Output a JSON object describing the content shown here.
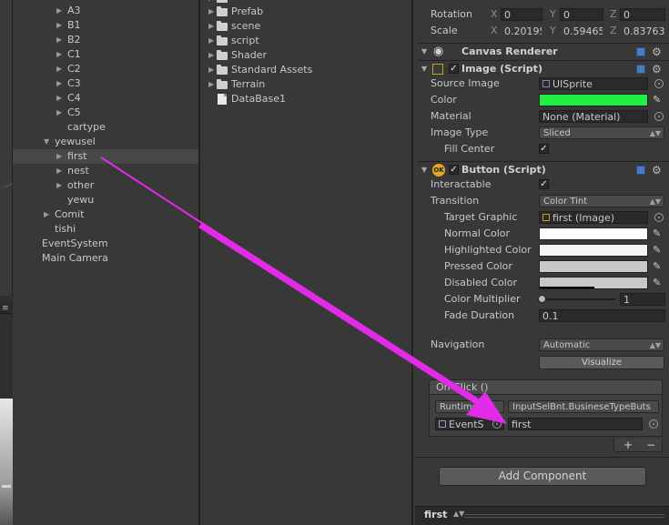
{
  "hierarchy": {
    "items": [
      {
        "label": "A3",
        "indent": 3,
        "expand": "collapsed"
      },
      {
        "label": "B1",
        "indent": 3,
        "expand": "collapsed"
      },
      {
        "label": "B2",
        "indent": 3,
        "expand": "collapsed"
      },
      {
        "label": "C1",
        "indent": 3,
        "expand": "collapsed"
      },
      {
        "label": "C2",
        "indent": 3,
        "expand": "collapsed"
      },
      {
        "label": "C3",
        "indent": 3,
        "expand": "collapsed"
      },
      {
        "label": "C4",
        "indent": 3,
        "expand": "collapsed"
      },
      {
        "label": "C5",
        "indent": 3,
        "expand": "collapsed"
      },
      {
        "label": "cartype",
        "indent": 3,
        "expand": "none"
      },
      {
        "label": "yewusel",
        "indent": 2,
        "expand": "expanded"
      },
      {
        "label": "first",
        "indent": 3,
        "expand": "collapsed",
        "selected": true
      },
      {
        "label": "nest",
        "indent": 3,
        "expand": "collapsed"
      },
      {
        "label": "other",
        "indent": 3,
        "expand": "collapsed"
      },
      {
        "label": "yewu",
        "indent": 3,
        "expand": "none"
      },
      {
        "label": "Comit",
        "indent": 2,
        "expand": "collapsed"
      },
      {
        "label": "tishi",
        "indent": 2,
        "expand": "none"
      },
      {
        "label": "EventSystem",
        "indent": 1,
        "expand": "none"
      },
      {
        "label": "Main Camera",
        "indent": 1,
        "expand": "none"
      }
    ]
  },
  "project": {
    "items": [
      {
        "label": "Prefab",
        "type": "folder"
      },
      {
        "label": "scene",
        "type": "folder"
      },
      {
        "label": "script",
        "type": "folder"
      },
      {
        "label": "Shader",
        "type": "folder"
      },
      {
        "label": "Standard Assets",
        "type": "folder"
      },
      {
        "label": "Terrain",
        "type": "folder"
      },
      {
        "label": "DataBase1",
        "type": "file"
      }
    ]
  },
  "inspector": {
    "transform": {
      "rotation_label": "Rotation",
      "rotation": {
        "x": "0",
        "y": "0",
        "z": "0"
      },
      "scale_label": "Scale",
      "scale": {
        "x": "0.20195",
        "y": "0.59465",
        "z": "0.83763"
      },
      "axis_x": "X",
      "axis_y": "Y",
      "axis_z": "Z"
    },
    "canvas_renderer": {
      "title": "Canvas Renderer"
    },
    "image": {
      "title": "Image (Script)",
      "source_image_label": "Source Image",
      "source_image_value": "UISprite",
      "color_label": "Color",
      "color_value": "#22ee44",
      "material_label": "Material",
      "material_value": "None (Material)",
      "image_type_label": "Image Type",
      "image_type_value": "Sliced",
      "fill_center_label": "Fill Center"
    },
    "button": {
      "title": "Button (Script)",
      "interactable_label": "Interactable",
      "transition_label": "Transition",
      "transition_value": "Color Tint",
      "target_graphic_label": "Target Graphic",
      "target_graphic_value": "first (Image)",
      "normal_color_label": "Normal Color",
      "normal_color_value": "#ffffff",
      "highlighted_color_label": "Highlighted Color",
      "highlighted_color_value": "#f5f5f5",
      "pressed_color_label": "Pressed Color",
      "pressed_color_value": "#c8c8c8",
      "disabled_color_label": "Disabled Color",
      "disabled_color_value": "#c8c8c8",
      "color_multiplier_label": "Color Multiplier",
      "color_multiplier_value": "1",
      "fade_duration_label": "Fade Duration",
      "fade_duration_value": "0.1",
      "navigation_label": "Navigation",
      "navigation_value": "Automatic",
      "visualize_label": "Visualize"
    },
    "onclick": {
      "header": "On Click ()",
      "runtime_value": "Runtime O",
      "function_value": "InputSelBnt.BusineseTypeButs",
      "object_value": "EventS",
      "argument_value": "first",
      "add_label": "+",
      "remove_label": "−"
    },
    "add_component_label": "Add Component"
  },
  "bottom_bar": {
    "label": "first"
  },
  "colors": {
    "annotation_arrow": "#e12be6",
    "image_color": "#22ee44"
  }
}
